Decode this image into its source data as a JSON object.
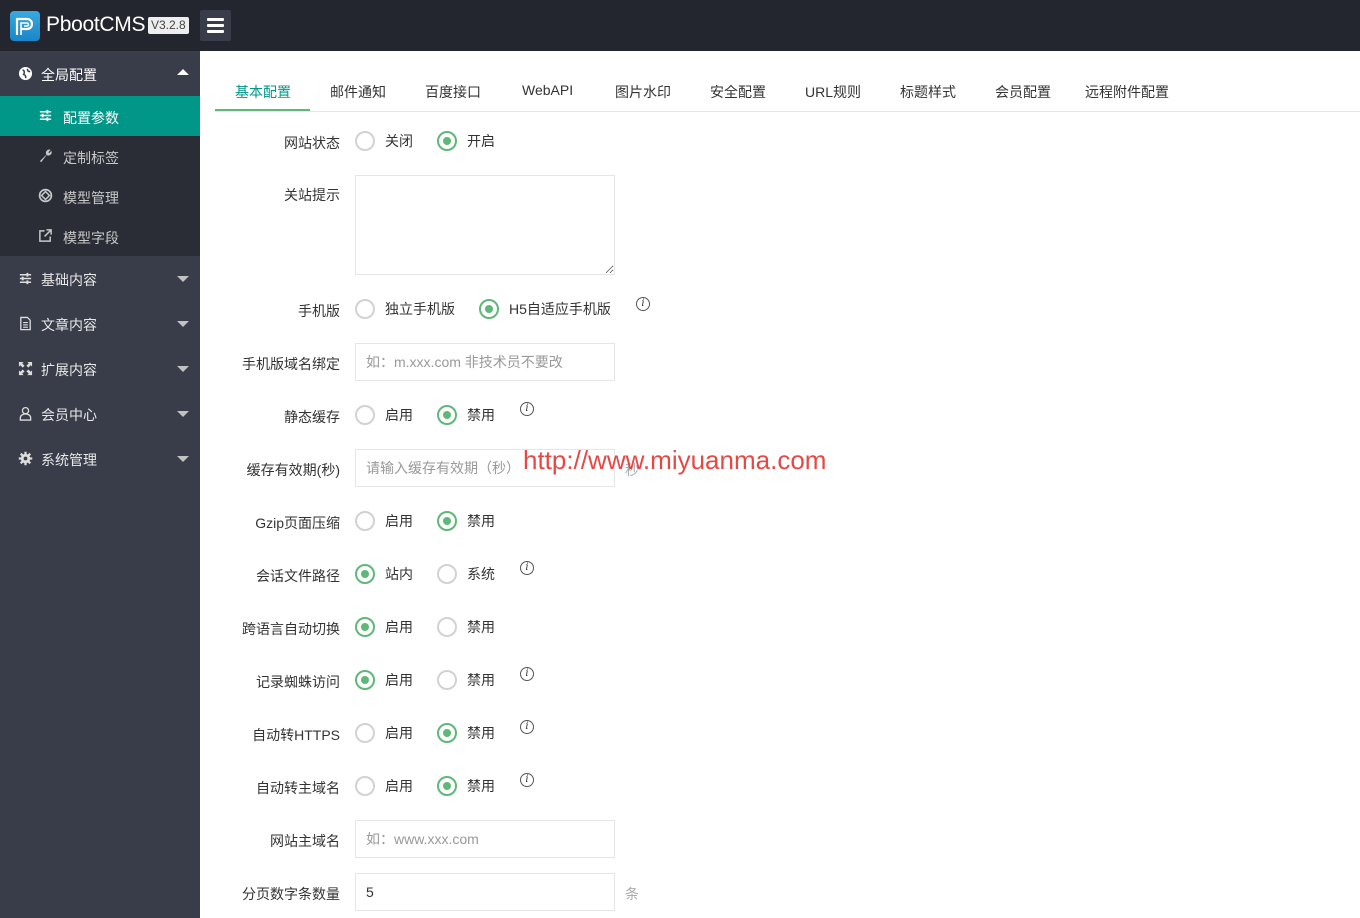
{
  "header": {
    "brand": "PbootCMS",
    "version": "V3.2.8",
    "logo_icon": "pboot-logo-icon",
    "menu_icon": "hamburger-icon"
  },
  "sidebar": {
    "groups": [
      {
        "label": "全局配置",
        "icon": "globe-icon",
        "expanded": true,
        "items": [
          {
            "label": "配置参数",
            "icon": "sliders-icon",
            "active": true
          },
          {
            "label": "定制标签",
            "icon": "wrench-icon",
            "active": false
          },
          {
            "label": "模型管理",
            "icon": "cube-icon",
            "active": false
          },
          {
            "label": "模型字段",
            "icon": "external-link-icon",
            "active": false
          }
        ]
      },
      {
        "label": "基础内容",
        "icon": "sliders-icon",
        "expanded": false
      },
      {
        "label": "文章内容",
        "icon": "file-icon",
        "expanded": false
      },
      {
        "label": "扩展内容",
        "icon": "expand-icon",
        "expanded": false
      },
      {
        "label": "会员中心",
        "icon": "user-icon",
        "expanded": false
      },
      {
        "label": "系统管理",
        "icon": "gear-icon",
        "expanded": false
      }
    ]
  },
  "tabs": [
    "基本配置",
    "邮件通知",
    "百度接口",
    "WebAPI",
    "图片水印",
    "安全配置",
    "URL规则",
    "标题样式",
    "会员配置",
    "远程附件配置"
  ],
  "active_tab": "基本配置",
  "form": {
    "site_status": {
      "label": "网站状态",
      "options": [
        "关闭",
        "开启"
      ],
      "selected": "开启"
    },
    "close_tip": {
      "label": "关站提示",
      "value": ""
    },
    "mobile": {
      "label": "手机版",
      "options": [
        "独立手机版",
        "H5自适应手机版"
      ],
      "selected": "H5自适应手机版"
    },
    "mobile_domain": {
      "label": "手机版域名绑定",
      "placeholder": "如：m.xxx.com 非技术员不要改",
      "value": ""
    },
    "static_cache": {
      "label": "静态缓存",
      "options": [
        "启用",
        "禁用"
      ],
      "selected": "禁用"
    },
    "cache_time": {
      "label": "缓存有效期(秒)",
      "placeholder": "请输入缓存有效期（秒）",
      "value": "",
      "suffix": "秒"
    },
    "gzip": {
      "label": "Gzip页面压缩",
      "options": [
        "启用",
        "禁用"
      ],
      "selected": "禁用"
    },
    "session_path": {
      "label": "会话文件路径",
      "options": [
        "站内",
        "系统"
      ],
      "selected": "站内"
    },
    "lang_switch": {
      "label": "跨语言自动切换",
      "options": [
        "启用",
        "禁用"
      ],
      "selected": "启用"
    },
    "spider_log": {
      "label": "记录蜘蛛访问",
      "options": [
        "启用",
        "禁用"
      ],
      "selected": "启用"
    },
    "https": {
      "label": "自动转HTTPS",
      "options": [
        "启用",
        "禁用"
      ],
      "selected": "禁用"
    },
    "main_domain_redirect": {
      "label": "自动转主域名",
      "options": [
        "启用",
        "禁用"
      ],
      "selected": "禁用"
    },
    "main_domain": {
      "label": "网站主域名",
      "placeholder": "如：www.xxx.com",
      "value": ""
    },
    "page_num": {
      "label": "分页数字条数量",
      "value": "5",
      "suffix": "条"
    }
  },
  "watermark": "http://www.miyuanma.com",
  "colors": {
    "header": "#23262e",
    "sidebar": "#393d49",
    "active": "#009688",
    "radio": "#5fb878"
  }
}
